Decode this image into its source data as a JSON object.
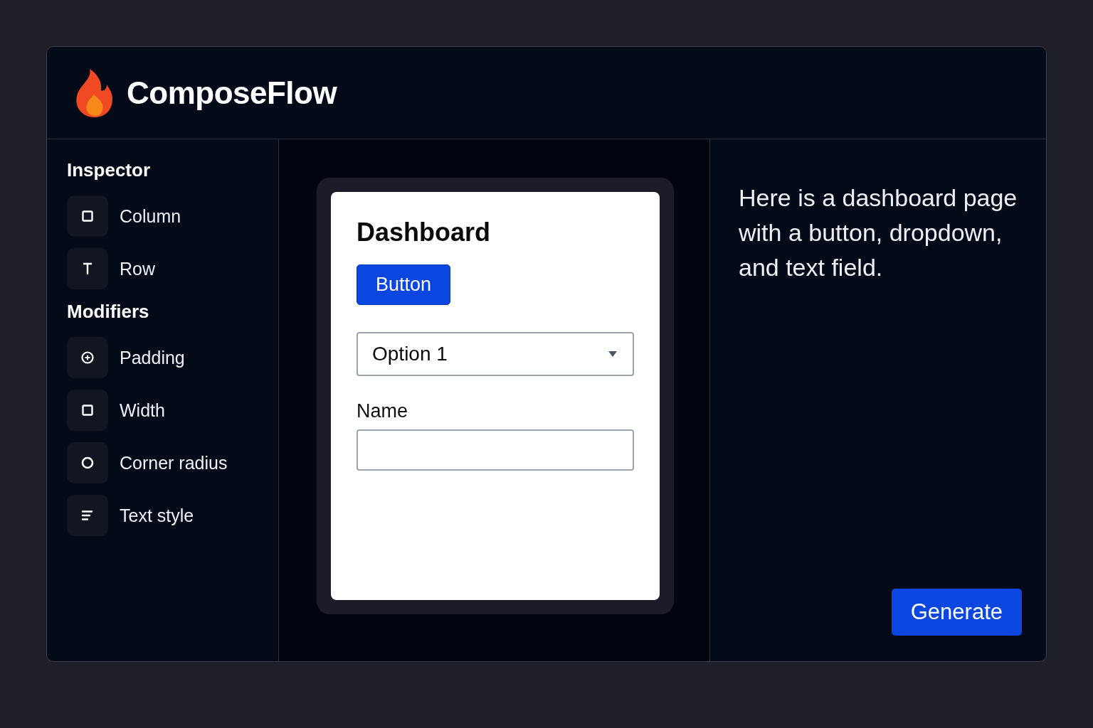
{
  "app": {
    "name": "ComposeFlow"
  },
  "sidebar": {
    "sections": [
      {
        "title": "Inspector",
        "items": [
          {
            "label": "Column",
            "kind": "square"
          },
          {
            "label": "Row",
            "kind": "text"
          }
        ]
      },
      {
        "title": "Modifiers",
        "items": [
          {
            "label": "Padding",
            "kind": "plus-circle"
          },
          {
            "label": "Width",
            "kind": "square"
          },
          {
            "label": "Corner radius",
            "kind": "circle"
          },
          {
            "label": "Text style",
            "kind": "lines"
          }
        ]
      }
    ]
  },
  "preview": {
    "title": "Dashboard",
    "button": "Button",
    "dropdown": {
      "value": "Option 1"
    },
    "text_field": {
      "label": "Name"
    }
  },
  "assistant": {
    "message": "Here is a dashboard page with a button, dropdown, and text field.",
    "button": "Generate"
  }
}
